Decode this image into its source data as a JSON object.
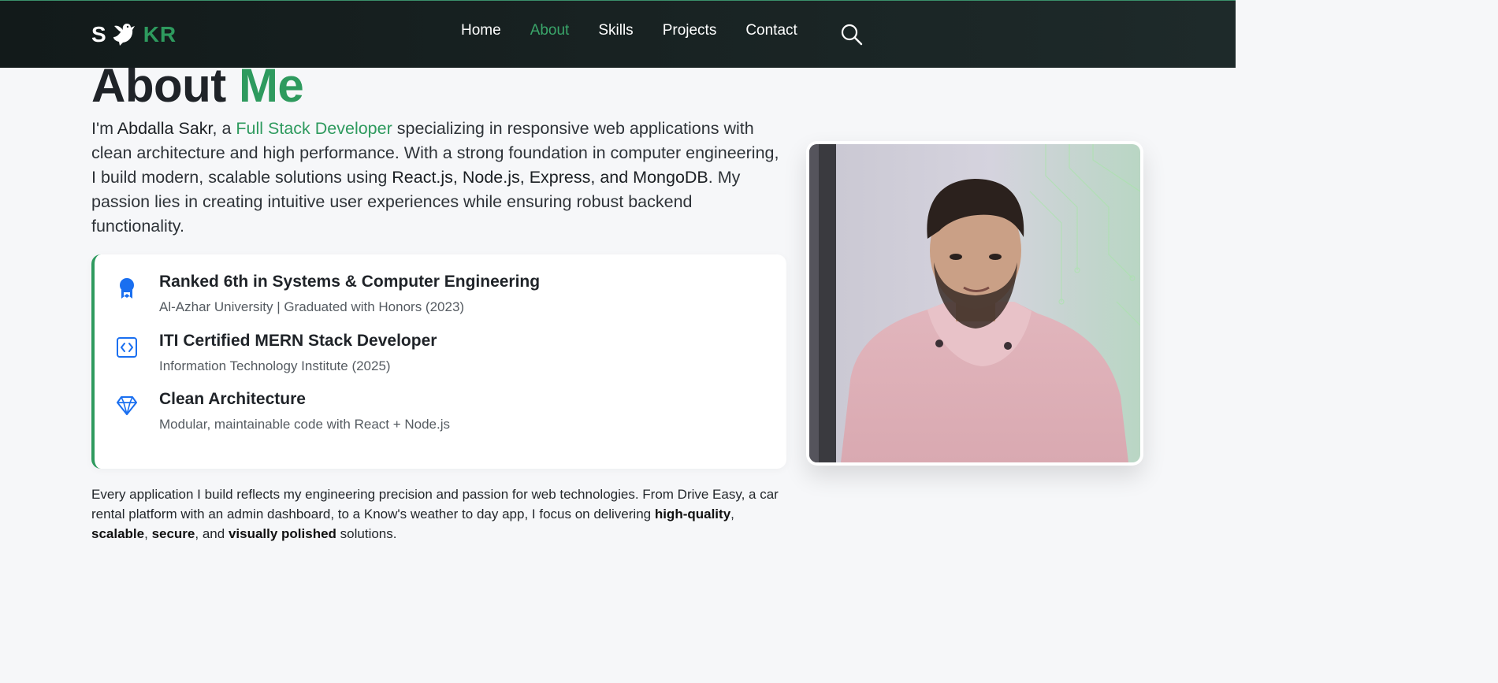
{
  "brand": {
    "logo_left": "S",
    "logo_right": "KR",
    "logo_icon": "dove-icon",
    "accent_color": "#2e9a5e"
  },
  "nav": {
    "items": [
      {
        "label": "Home",
        "active": false
      },
      {
        "label": "About",
        "active": true
      },
      {
        "label": "Skills",
        "active": false
      },
      {
        "label": "Projects",
        "active": false
      },
      {
        "label": "Contact",
        "active": false
      }
    ],
    "search_icon": "search-icon"
  },
  "about": {
    "title_main": "About",
    "title_accent": "Me",
    "intro": {
      "p1": "I'm ",
      "name": "Abdalla Sakr",
      "p2": ", a ",
      "role": "Full Stack Developer",
      "p3": " specializing in responsive web applications with clean architecture and high performance. With a strong foundation in computer engineering, I build modern, scalable solutions using ",
      "stack": "React.js, Node.js, Express, and MongoDB",
      "p4": ". My passion lies in creating intuitive user experiences while ensuring robust backend functionality."
    },
    "highlights": [
      {
        "icon": "award-icon",
        "title": "Ranked 6th in Systems & Computer Engineering",
        "subtitle": "Al-Azhar University | Graduated with Honors (2023)"
      },
      {
        "icon": "code-icon",
        "title": "ITI Certified MERN Stack Developer",
        "subtitle": "Information Technology Institute (2025)"
      },
      {
        "icon": "diamond-icon",
        "title": "Clean Architecture",
        "subtitle": "Modular, maintainable code with React + Node.js"
      }
    ],
    "outro": {
      "p1": "Every application I build reflects my engineering precision and passion for web technologies. From Drive Easy, a car rental platform with an admin dashboard, to a Know's weather to day app, I focus on delivering ",
      "b1": "high-quality",
      "s1": ", ",
      "b2": "scalable",
      "s2": ", ",
      "b3": "secure",
      "s3": ", and ",
      "b4": "visually polished",
      "p2": " solutions."
    },
    "photo_alt": "profile-photo"
  }
}
